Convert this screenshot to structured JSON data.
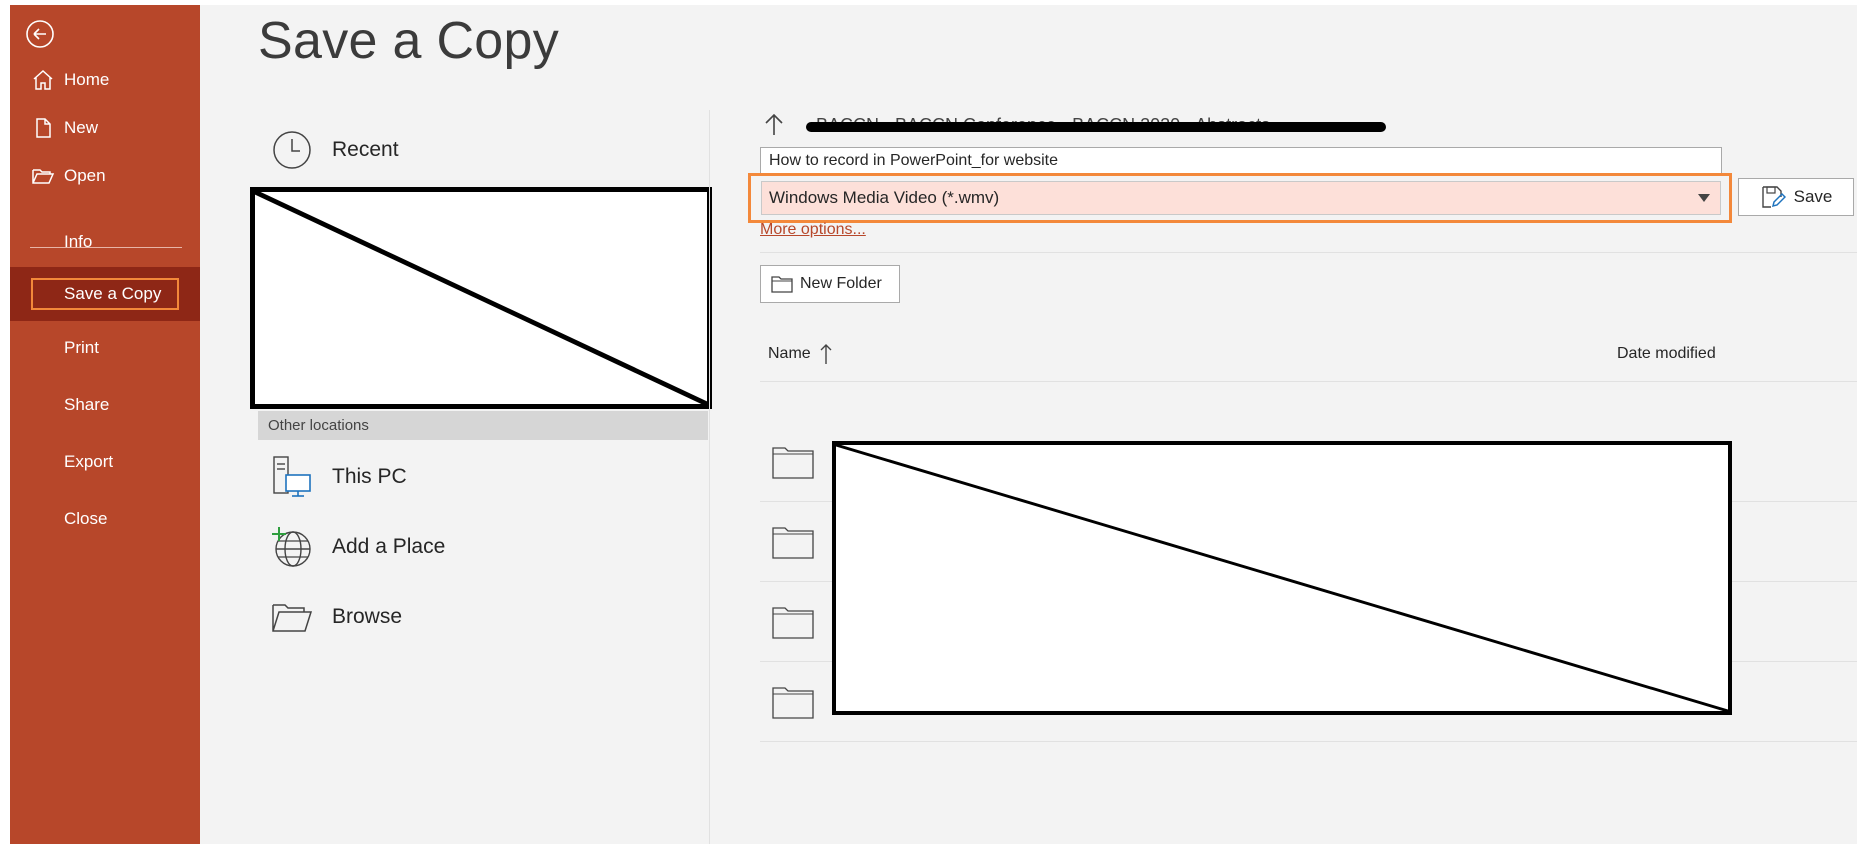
{
  "sidebar": {
    "back_icon": "back-arrow-circle-icon",
    "items": [
      {
        "label": "Home",
        "icon": "home-icon"
      },
      {
        "label": "New",
        "icon": "new-document-icon"
      },
      {
        "label": "Open",
        "icon": "open-folder-icon"
      },
      {
        "label": "Info"
      },
      {
        "label": "Save a Copy",
        "selected": true
      },
      {
        "label": "Print"
      },
      {
        "label": "Share"
      },
      {
        "label": "Export"
      },
      {
        "label": "Close"
      }
    ]
  },
  "main": {
    "title": "Save a Copy",
    "locations": {
      "recent_label": "Recent",
      "other_locations_header": "Other locations",
      "this_pc_label": "This PC",
      "add_place_label": "Add a Place",
      "browse_label": "Browse"
    },
    "file_panel": {
      "path_text": "BACCN › BACCN Conference › BACCN 2020 › Abstracts",
      "filename_value": "How to record in PowerPoint_for website",
      "filetype_value": "Windows Media Video (*.wmv)",
      "save_label": "Save",
      "more_options_label": "More options...",
      "new_folder_label": "New Folder",
      "columns": {
        "name": "Name",
        "date_modified": "Date modified"
      },
      "folder_count": 4
    }
  },
  "colors": {
    "sidebar_bg": "#b7472a",
    "sidebar_selected_bg": "#8e2716",
    "highlight_orange": "#f3883a",
    "filetype_bg": "#fde0d9",
    "main_bg": "#f3f3f3"
  }
}
